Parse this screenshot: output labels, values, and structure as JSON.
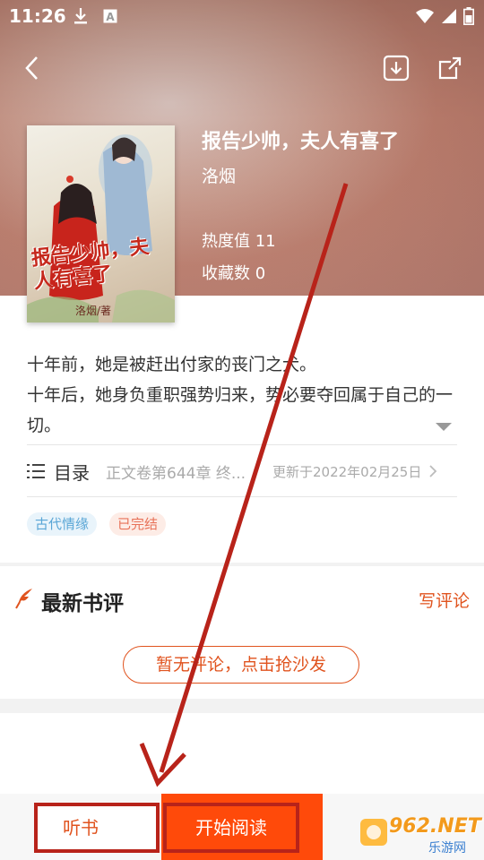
{
  "status_bar": {
    "time": "11:26"
  },
  "book": {
    "title": "报告少帅，夫人有喜了",
    "author": "洛烟",
    "heat_label": "热度值 11",
    "fav_label": "收藏数 0",
    "cover_title": "报告少帅，夫人有喜了",
    "cover_author": "洛烟/著"
  },
  "description": {
    "line1": "十年前，她是被赶出付家的丧门之犬。",
    "line2": "十年后，她身负重职强势归来，势必要夺回属于自己的一切。"
  },
  "toc": {
    "label": "目录",
    "chapter": "正文卷第644章 终...",
    "updated": "更新于2022年02月25日"
  },
  "tags": [
    "古代情缘",
    "已完结"
  ],
  "review": {
    "title": "最新书评",
    "write_label": "写评论",
    "empty_label": "暂无评论，点击抢沙发"
  },
  "bottom": {
    "listen_label": "听书",
    "read_label": "开始阅读"
  },
  "watermark": {
    "site": "962.NET",
    "sub": "乐游网"
  },
  "colors": {
    "accent": "#e0531e",
    "read_button": "#ff4a0a",
    "annotation": "#b8231a"
  }
}
